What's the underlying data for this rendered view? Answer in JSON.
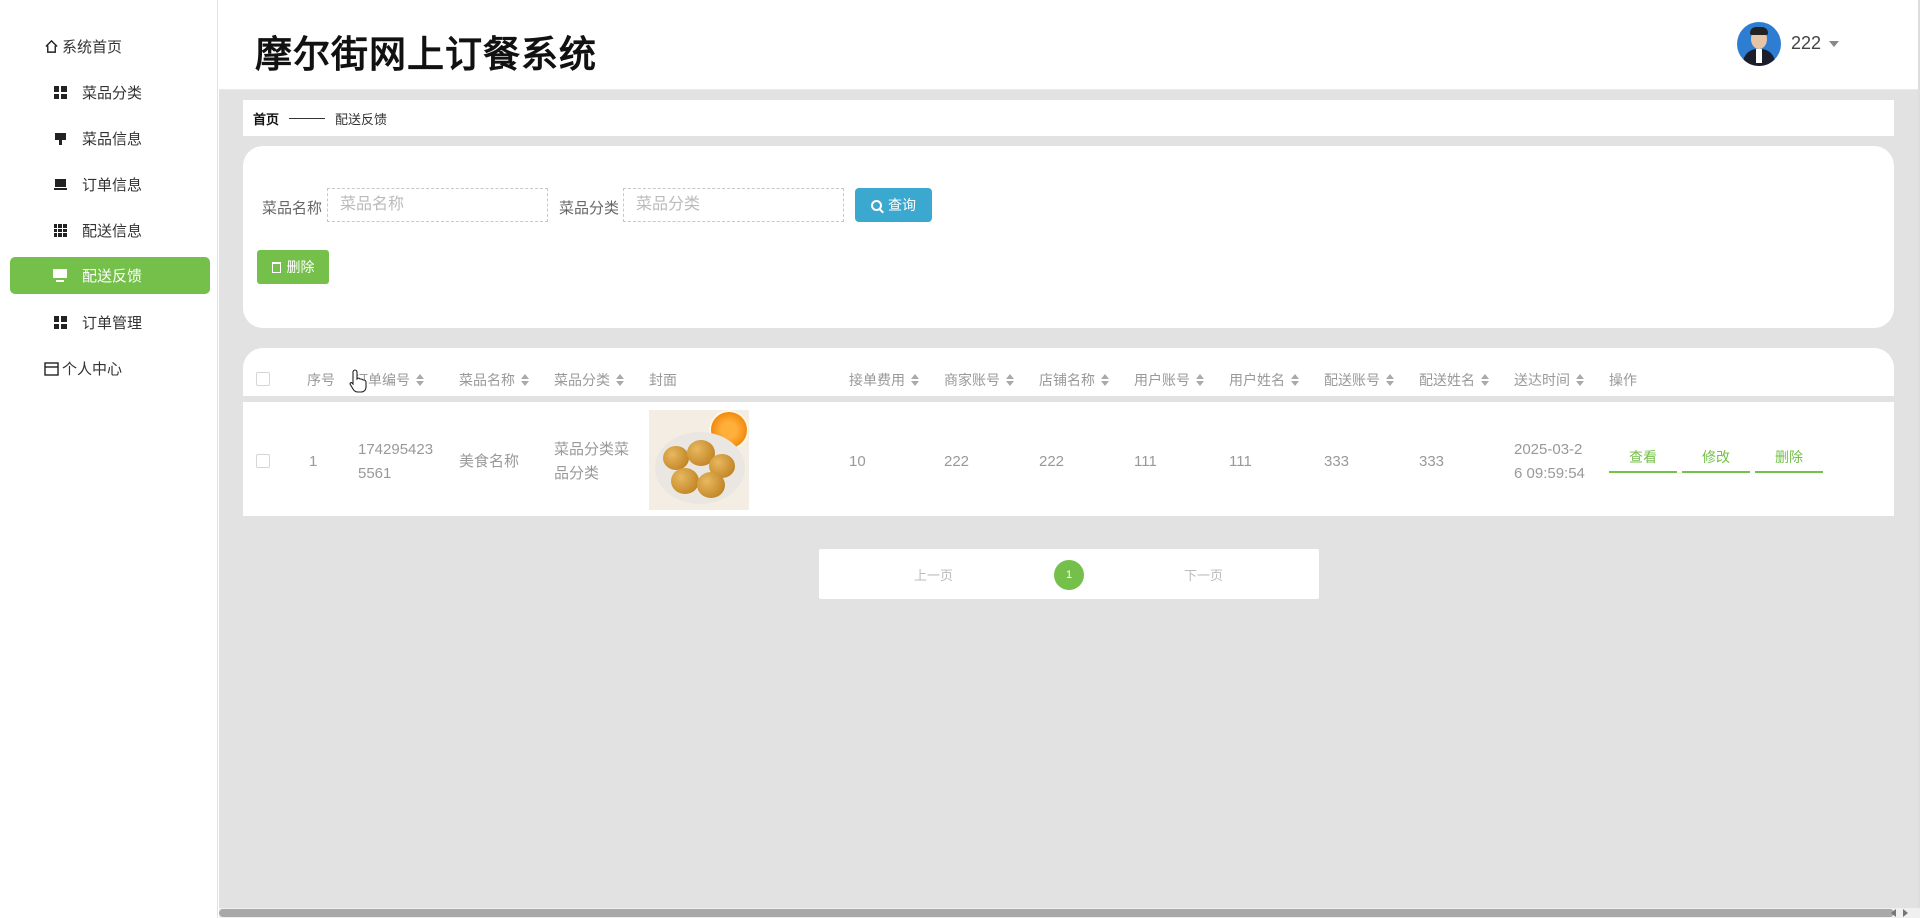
{
  "app": {
    "title": "摩尔街网上订餐系统"
  },
  "user": {
    "name": "222"
  },
  "sidebar": {
    "items": [
      {
        "label": "系统首页",
        "icon": "home-icon"
      },
      {
        "label": "菜品分类",
        "icon": "grid-icon"
      },
      {
        "label": "菜品信息",
        "icon": "food-icon"
      },
      {
        "label": "订单信息",
        "icon": "order-icon"
      },
      {
        "label": "配送信息",
        "icon": "apps-icon"
      },
      {
        "label": "配送反馈",
        "icon": "monitor-icon",
        "active": true
      },
      {
        "label": "订单管理",
        "icon": "grid-icon"
      },
      {
        "label": "个人中心",
        "icon": "profile-icon"
      }
    ]
  },
  "breadcrumb": {
    "home": "首页",
    "current": "配送反馈"
  },
  "search": {
    "name_label": "菜品名称",
    "name_placeholder": "菜品名称",
    "category_label": "菜品分类",
    "category_placeholder": "菜品分类",
    "query_button": "查询",
    "delete_button": "删除"
  },
  "table": {
    "columns": [
      "序号",
      "订单编号",
      "菜品名称",
      "菜品分类",
      "封面",
      "接单费用",
      "商家账号",
      "店铺名称",
      "用户账号",
      "用户姓名",
      "配送账号",
      "配送姓名",
      "送达时间",
      "操作"
    ],
    "rows": [
      {
        "index": "1",
        "order_no_line1": "174295423",
        "order_no_line2": "5561",
        "dish_name": "美食名称",
        "category_line1": "菜品分类菜",
        "category_line2": "品分类",
        "fee": "10",
        "merchant_account": "222",
        "shop_name": "222",
        "user_account": "111",
        "user_name": "111",
        "delivery_account": "333",
        "delivery_name": "333",
        "delivered_line1": "2025-03-2",
        "delivered_line2": "6 09:59:54",
        "actions": {
          "view": "查看",
          "edit": "修改",
          "delete": "删除"
        }
      }
    ]
  },
  "pagination": {
    "prev": "上一页",
    "current": "1",
    "next": "下一页"
  },
  "colors": {
    "accent": "#74c04a",
    "query": "#3ba8cf",
    "background": "#e2e2e2"
  }
}
